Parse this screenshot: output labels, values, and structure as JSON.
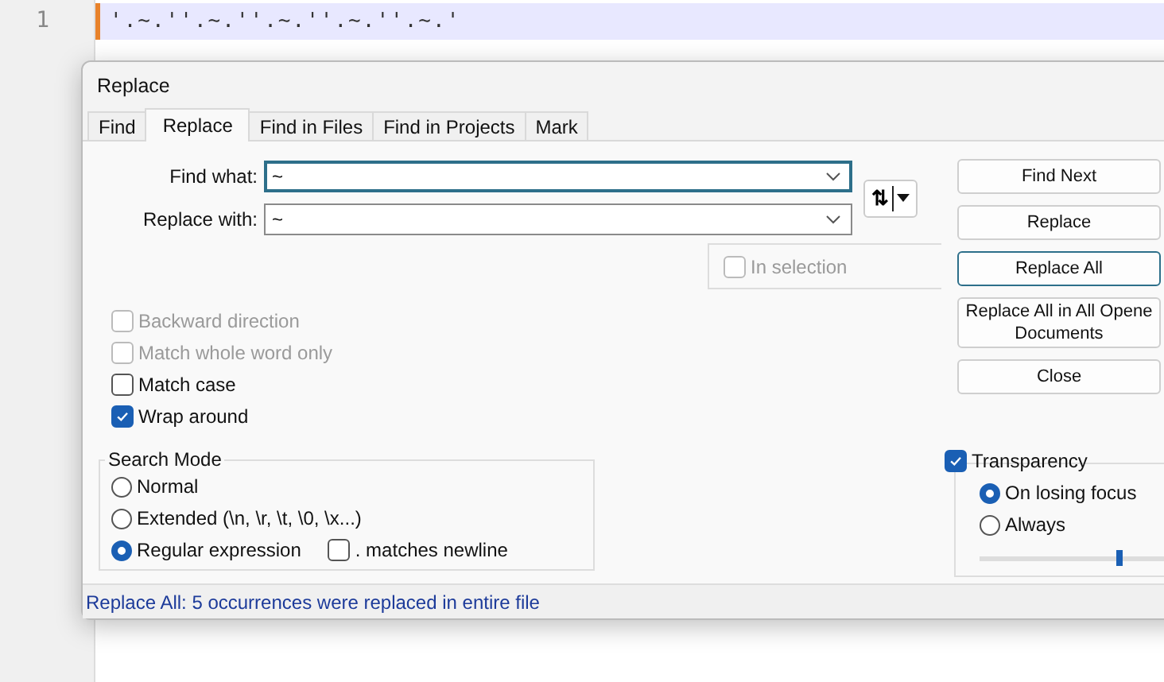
{
  "editor": {
    "line_number": "1",
    "line_text": "'.~.''.~.''.~.''.~.''.~.'"
  },
  "dialog": {
    "title": "Replace",
    "tabs": [
      {
        "label": "Find",
        "selected": false
      },
      {
        "label": "Replace",
        "selected": true
      },
      {
        "label": "Find in Files",
        "selected": false
      },
      {
        "label": "Find in Projects",
        "selected": false
      },
      {
        "label": "Mark",
        "selected": false
      }
    ],
    "find_what": {
      "label": "Find what:",
      "value": "~"
    },
    "replace_with": {
      "label": "Replace with:",
      "value": "~"
    },
    "swap_button": {
      "label": "⇅"
    },
    "in_selection": {
      "label": "In selection",
      "checked": false,
      "disabled": true
    },
    "options": [
      {
        "label": "Backward direction",
        "checked": false,
        "disabled": true
      },
      {
        "label": "Match whole word only",
        "checked": false,
        "disabled": true
      },
      {
        "label": "Match case",
        "checked": false,
        "disabled": false
      },
      {
        "label": "Wrap around",
        "checked": true,
        "disabled": false
      }
    ],
    "search_mode": {
      "title": "Search Mode",
      "modes": [
        {
          "label": "Normal",
          "selected": false
        },
        {
          "label": "Extended (\\n, \\r, \\t, \\0, \\x...)",
          "selected": false
        },
        {
          "label": "Regular expression",
          "selected": true
        }
      ],
      "matches_newline": {
        "label": ". matches newline",
        "checked": false
      }
    },
    "buttons": [
      {
        "label": "Find Next",
        "focused": false
      },
      {
        "label": "Replace",
        "focused": false
      },
      {
        "label": "Replace All",
        "focused": true
      },
      {
        "label": "Replace All in All Opene\nDocuments",
        "focused": false
      },
      {
        "label": "Close",
        "focused": false
      }
    ],
    "transparency": {
      "label": "Transparency",
      "checked": true,
      "modes": [
        {
          "label": "On losing focus",
          "selected": true
        },
        {
          "label": "Always",
          "selected": false
        }
      ],
      "level": 0.68
    },
    "status": "Replace All: 5 occurrences were replaced in entire file"
  }
}
